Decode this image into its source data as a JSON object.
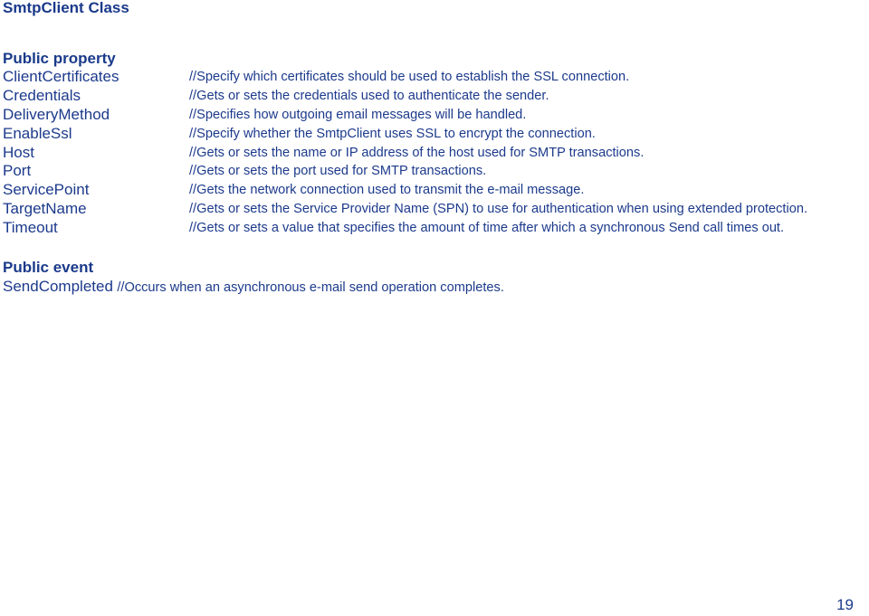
{
  "title": "SmtpClient Class",
  "properties_section": {
    "heading": "Public property",
    "items": [
      {
        "name": "ClientCertificates",
        "description": "//Specify which certificates should be used to establish the SSL connection."
      },
      {
        "name": "Credentials",
        "description": "//Gets or sets the credentials used to authenticate the sender."
      },
      {
        "name": "DeliveryMethod",
        "description": "//Specifies how outgoing email messages will be handled."
      },
      {
        "name": "EnableSsl",
        "description": "//Specify whether the SmtpClient uses SSL to encrypt the connection."
      },
      {
        "name": "Host",
        "description": "//Gets or sets the name or IP address of the host used for SMTP transactions."
      },
      {
        "name": "Port",
        "description": "//Gets or sets the port used for SMTP transactions."
      },
      {
        "name": "ServicePoint",
        "description": "//Gets the network connection used to transmit the e-mail message."
      },
      {
        "name": "TargetName",
        "description": "//Gets or sets the Service Provider Name (SPN) to use for authentication when using extended protection."
      },
      {
        "name": "Timeout",
        "description": "//Gets or sets a value that specifies the amount of time after which a synchronous Send call times out."
      }
    ]
  },
  "events_section": {
    "heading": "Public event",
    "items": [
      {
        "name": "SendCompleted",
        "description": "//Occurs when an asynchronous e-mail send operation completes."
      }
    ]
  },
  "page_number": "19",
  "colors": {
    "text": "#1c3a8c",
    "heading": "#1a3a8a",
    "background": "#ffffff"
  }
}
